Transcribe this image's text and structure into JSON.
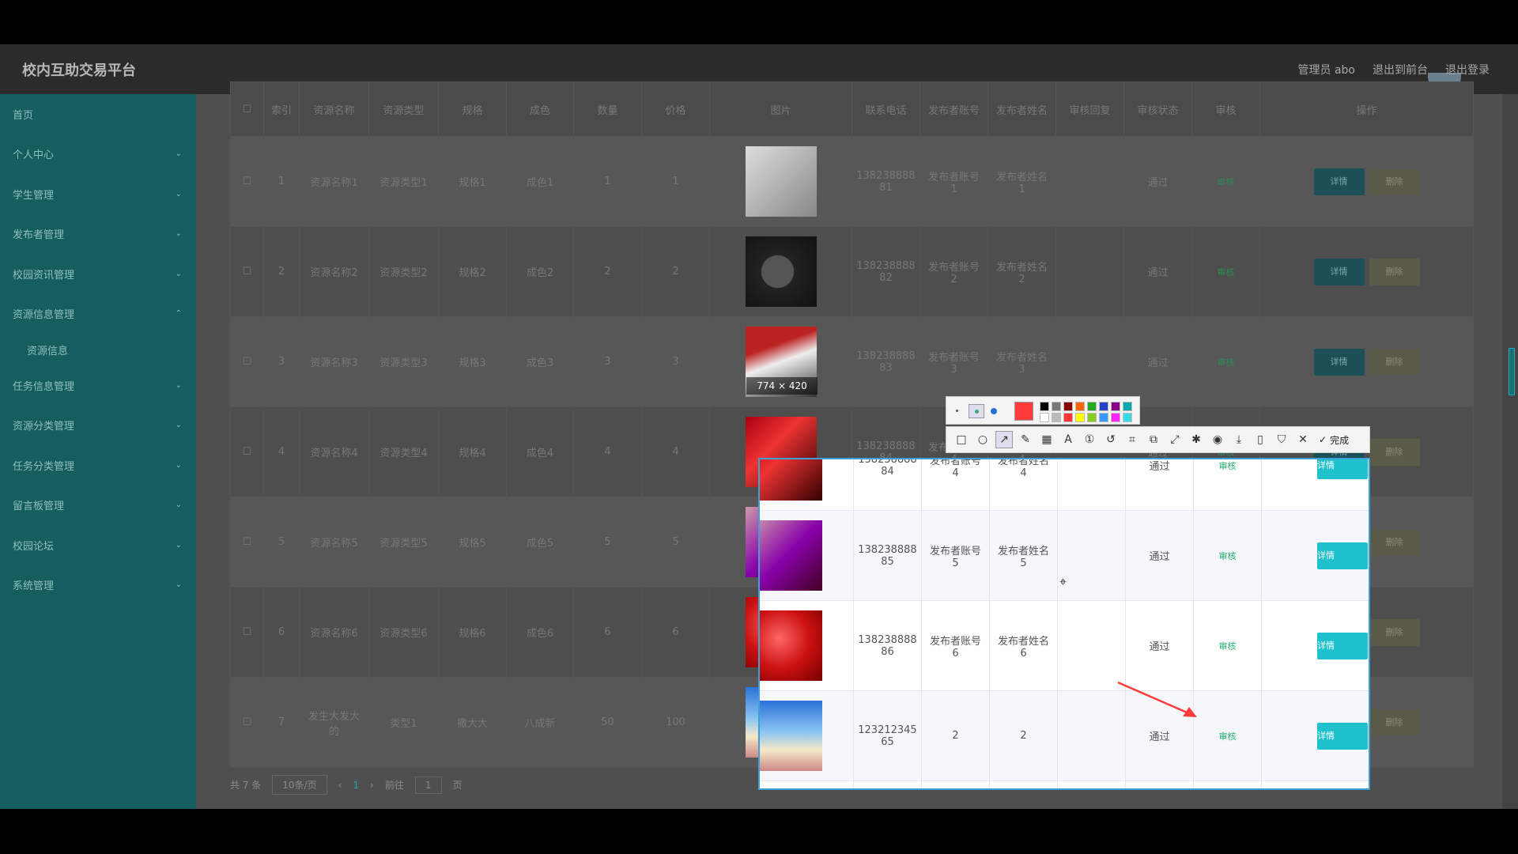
{
  "header": {
    "title": "校内互助交易平台",
    "links": [
      "管理员 abo",
      "退出到前台",
      "退出登录"
    ]
  },
  "sidebar": {
    "items": [
      {
        "label": "首页",
        "chev": ""
      },
      {
        "label": "个人中心",
        "chev": "⌄"
      },
      {
        "label": "学生管理",
        "chev": "⌄"
      },
      {
        "label": "发布者管理",
        "chev": "⌄"
      },
      {
        "label": "校园资讯管理",
        "chev": "⌄"
      },
      {
        "label": "资源信息管理",
        "chev": "⌃"
      },
      {
        "label": "资源信息",
        "chev": "",
        "sub": true
      },
      {
        "label": "任务信息管理",
        "chev": "⌄"
      },
      {
        "label": "资源分类管理",
        "chev": "⌄"
      },
      {
        "label": "任务分类管理",
        "chev": "⌄"
      },
      {
        "label": "留言板管理",
        "chev": "⌄"
      },
      {
        "label": "校园论坛",
        "chev": "⌄"
      },
      {
        "label": "系统管理",
        "chev": "⌄"
      }
    ]
  },
  "table": {
    "headers": [
      "索引",
      "资源名称",
      "资源类型",
      "规格",
      "成色",
      "数量",
      "价格",
      "图片",
      "联系电话",
      "发布者账号",
      "发布者姓名",
      "审核回复",
      "审核状态",
      "审核",
      "操作"
    ],
    "rows": [
      {
        "idx": "1",
        "name": "资源名称1",
        "type": "资源类型1",
        "spec": "规格1",
        "cond": "成色1",
        "qty": "1",
        "price": "1",
        "phone": "138238888\n81",
        "acct": "发布者账号\n1",
        "pname": "发布者姓名\n1",
        "reply": "",
        "status": "通过",
        "img": "book"
      },
      {
        "idx": "2",
        "name": "资源名称2",
        "type": "资源类型2",
        "spec": "规格2",
        "cond": "成色2",
        "qty": "2",
        "price": "2",
        "phone": "138238888\n82",
        "acct": "发布者账号\n2",
        "pname": "发布者姓名\n2",
        "reply": "",
        "status": "通过",
        "img": "watch"
      },
      {
        "idx": "3",
        "name": "资源名称3",
        "type": "资源类型3",
        "spec": "规格3",
        "cond": "成色3",
        "qty": "3",
        "price": "3",
        "phone": "138238888\n83",
        "acct": "发布者账号\n3",
        "pname": "发布者姓名\n3",
        "reply": "",
        "status": "通过",
        "img": "shoes"
      },
      {
        "idx": "4",
        "name": "资源名称4",
        "type": "资源类型4",
        "spec": "规格4",
        "cond": "成色4",
        "qty": "4",
        "price": "4",
        "phone": "138238888\n84",
        "acct": "发布者账号\n4",
        "pname": "发布者姓名\n4",
        "reply": "",
        "status": "通过",
        "img": "red"
      },
      {
        "idx": "5",
        "name": "资源名称5",
        "type": "资源类型5",
        "spec": "规格5",
        "cond": "成色5",
        "qty": "5",
        "price": "5",
        "phone": "138238888\n85",
        "acct": "发布者账号\n5",
        "pname": "发布者姓名\n5",
        "reply": "",
        "status": "通过",
        "img": "cosmetic"
      },
      {
        "idx": "6",
        "name": "资源名称6",
        "type": "资源类型6",
        "spec": "规格6",
        "cond": "成色6",
        "qty": "6",
        "price": "6",
        "phone": "138238888\n86",
        "acct": "发布者账号\n6",
        "pname": "发布者姓名\n6",
        "reply": "",
        "status": "通过",
        "img": "cherry"
      },
      {
        "idx": "7",
        "name": "发生大发大\n的",
        "type": "类型1",
        "spec": "撒大大",
        "cond": "八成新",
        "qty": "50",
        "price": "100",
        "phone": "123212345\n65",
        "acct": "2",
        "pname": "2",
        "reply": "",
        "status": "通过",
        "img": "sky"
      }
    ],
    "approve_label": "审核",
    "detail_label": "详情",
    "delete_label": "删除"
  },
  "pagination": {
    "total": "共 7 条",
    "page_size": "10条/页",
    "current": "1",
    "goto_prefix": "前往",
    "goto_value": "1",
    "goto_suffix": "页"
  },
  "screenshot_tool": {
    "size_badge": "774 × 420",
    "done_label": "完成"
  },
  "colors": {
    "accent": "#1fc1cc",
    "sidebar": "#155d5f",
    "annotation": "#ff3b3b"
  }
}
